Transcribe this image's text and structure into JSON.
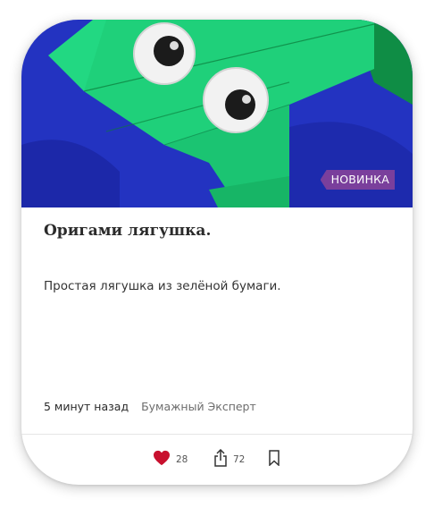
{
  "card": {
    "badge": "НОВИНКА",
    "title": "Оригами лягушка.",
    "description": "Простая лягушка из зелёной бумаги.",
    "time": "5 минут назад",
    "author": "Бумажный Эксперт"
  },
  "actions": {
    "likes": "28",
    "shares": "72"
  },
  "colors": {
    "badge_bg": "#7a3f9c",
    "heart": "#c8102e",
    "photo_background": "#1f2fb8",
    "paper_green": "#1fd07a"
  },
  "icons": {
    "like": "heart-icon",
    "share": "share-icon",
    "bookmark": "bookmark-icon"
  }
}
